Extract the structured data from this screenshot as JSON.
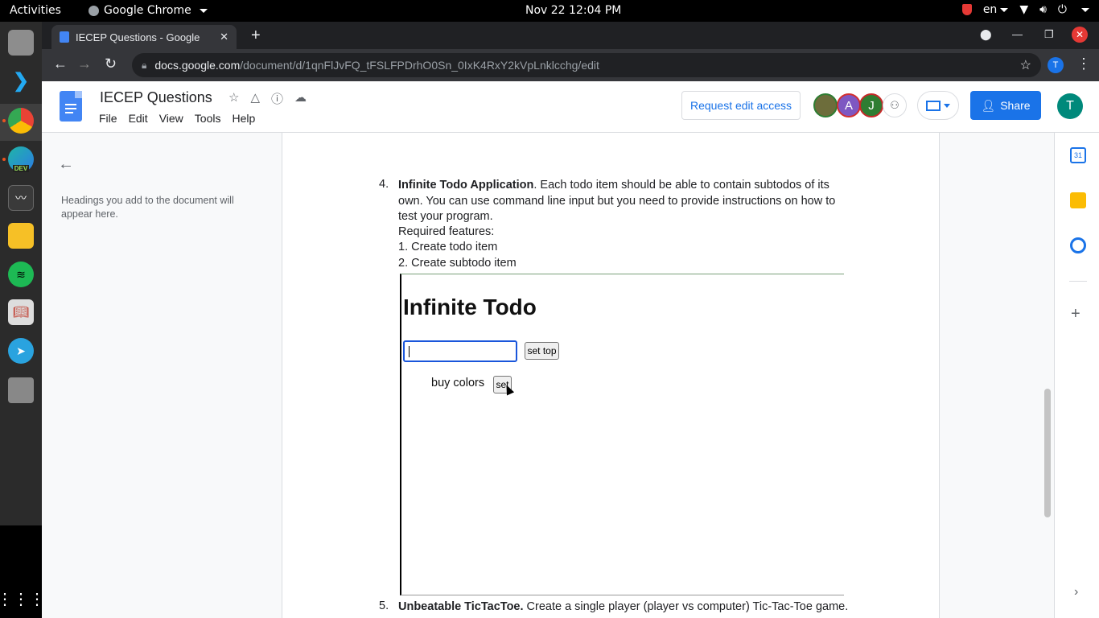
{
  "system_bar": {
    "activities": "Activities",
    "app_name": "Google Chrome",
    "clock": "Nov 22  12:04 PM",
    "language": "en"
  },
  "dock": {
    "apps": [
      "files-icon",
      "vscode-icon",
      "chrome-icon",
      "edge-dev-icon",
      "system-monitor-icon",
      "notes-icon",
      "spotify-icon",
      "reader-icon",
      "telegram-icon",
      "disk-icon"
    ],
    "dev_badge": "DEV"
  },
  "browser": {
    "tab_title": "IECEP Questions - Google",
    "url_host": "docs.google.com",
    "url_path": "/document/d/1qnFlJvFQ_tFSLFPDrhO0Sn_0IxK4RxY2kVpLnklcchg/edit",
    "profile_initial": "T"
  },
  "docs": {
    "title": "IECEP Questions",
    "menu": [
      "File",
      "Edit",
      "View",
      "Tools",
      "Help"
    ],
    "request_edit": "Request edit access",
    "share": "Share",
    "collaborators": [
      "A",
      "J"
    ],
    "user_initial": "T",
    "calendar_day": "31"
  },
  "outline": {
    "empty_text": "Headings you add to the document will appear here."
  },
  "content": {
    "item4_num": "4.",
    "item4_bold": "Infinite Todo Application",
    "item4_text": ". Each todo item should be able to contain subtodos of its own. You can use command line input but you need to provide instructions on how to test your program.",
    "required": "Required features:",
    "feature1": "1. Create todo item",
    "feature2": "2. Create subtodo item",
    "item5_num": "5.",
    "item5_bold": "Unbeatable TicTacToe.",
    "item5_text": " Create a single player (player vs computer) Tic-Tac-Toe game."
  },
  "embed": {
    "heading": "Infinite Todo",
    "set_top": "set top",
    "todo_item": "buy colors",
    "set": "set"
  }
}
